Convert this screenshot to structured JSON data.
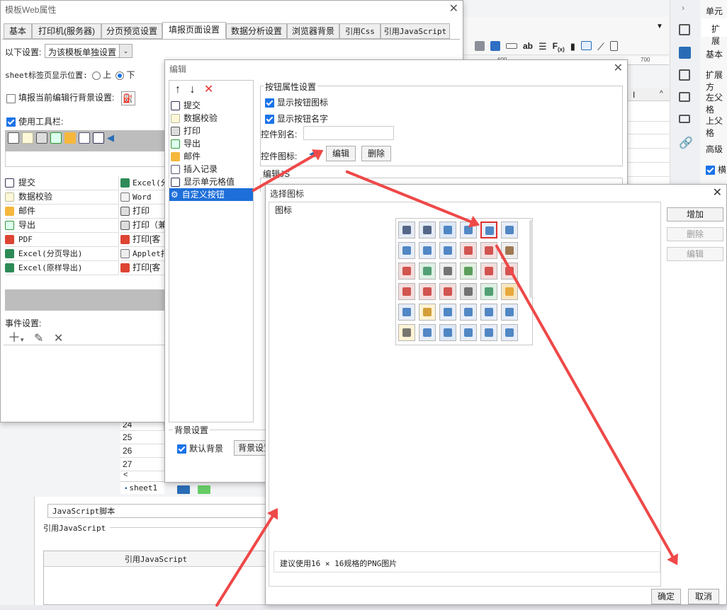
{
  "bg_window": {
    "toolbar_icons": [
      "table-icon",
      "grid-icon",
      "link-icon",
      "ab-icon",
      "align-icon",
      "formula-icon",
      "bar-chart-icon",
      "image-icon",
      "slash-icon",
      "doc-icon"
    ],
    "ruler_marks": [
      "600",
      "700"
    ],
    "row_numbers": [
      "24",
      "25",
      "26",
      "27"
    ],
    "sheet_tab": "sheet1",
    "col_label": "I",
    "js_script_label": "JavaScript脚本",
    "ref_js_label": "引用JavaScript",
    "ref_js_header": "引用JavaScript"
  },
  "right_panel": {
    "top_label": "单元格",
    "expand_label": "扩展",
    "basic": "基本",
    "expand_dir": "扩展方",
    "left_parent": "左父格",
    "top_parent": "上父格",
    "advanced": "高级",
    "horizontal": "横"
  },
  "web_props": {
    "title": "模板Web属性",
    "tabs": [
      "基本",
      "打印机(服务器)",
      "分页预览设置",
      "填报页面设置",
      "数据分析设置",
      "浏览器背景",
      "引用Css",
      "引用JavaScript"
    ],
    "setting_label": "以下设置:",
    "setting_value": "为该模板单独设置",
    "sheet_position_label": "sheet标签页显示位置:",
    "pos_top": "上",
    "pos_bottom": "下",
    "fill_bg_label": "填报当前编辑行背景设置:",
    "use_toolbar_label": "使用工具栏:",
    "left_list": [
      "提交",
      "数据校验",
      "邮件",
      "导出",
      "PDF",
      "Excel(分页导出)",
      "Excel(原样导出)"
    ],
    "right_list": [
      "Excel(分",
      "Word",
      "打印",
      "打印（兼",
      "打印[客",
      "Applet打",
      "打印[客"
    ],
    "event_label": "事件设置:"
  },
  "edit_dialog": {
    "title": "编辑",
    "items": [
      "提交",
      "数据校验",
      "打印",
      "导出",
      "邮件",
      "插入记录",
      "显示单元格值",
      "自定义按钮"
    ],
    "button_props_label": "按钮属性设置",
    "show_icon_label": "显示按钮图标",
    "show_name_label": "显示按钮名字",
    "alias_label": "控件别名:",
    "alias_value": "",
    "icon_label": "控件图标:",
    "edit_btn": "编辑",
    "delete_btn": "删除",
    "edit_js_label": "编辑JS",
    "bg_settings_label": "背景设置",
    "default_bg_label": "默认背景",
    "bg_settings_btn": "背景设置"
  },
  "icon_dialog": {
    "title": "选择图标",
    "section_label": "图标",
    "add_btn": "增加",
    "delete_btn": "删除",
    "edit_btn": "编辑",
    "hint": "建议使用16 × 16规格的PNG图片",
    "ok_btn": "确定",
    "cancel_btn": "取消",
    "icons": [
      [
        "save-icon",
        "save-icon",
        "copy-icon",
        "first-page-icon",
        "prev-page-icon",
        "next-page-icon"
      ],
      [
        "last-page-icon",
        "refresh-icon",
        "list-icon",
        "pdf-doc-icon",
        "pdf-icon",
        "applet-icon"
      ],
      [
        "pdf-icon",
        "excel-icon",
        "word-icon",
        "image-icon",
        "html-icon",
        "gif-icon"
      ],
      [
        "jpg-icon",
        "gif-icon",
        "png-icon",
        "print-icon",
        "export-icon",
        "mail-icon"
      ],
      [
        "form-icon",
        "edit-icon",
        "merge-icon",
        "split-icon",
        "tree-icon",
        "node-icon"
      ],
      [
        "ruler-icon",
        "add-doc-icon",
        "submit-icon",
        "undo-icon",
        "redo-icon",
        "numbered-list-icon"
      ]
    ]
  }
}
